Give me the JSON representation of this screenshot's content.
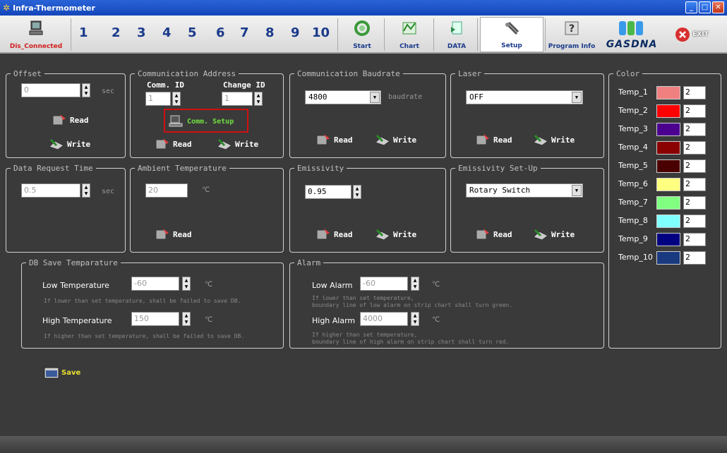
{
  "window": {
    "title": "Infra-Thermometer"
  },
  "toolbar": {
    "status": "Dis_Connected",
    "channels": [
      "1",
      "2",
      "3",
      "4",
      "5",
      "6",
      "7",
      "8",
      "9",
      "10"
    ],
    "start": "Start",
    "chart": "Chart",
    "data": "DATA",
    "setup": "Setup",
    "program_info": "Program Info",
    "brand": "GASDNA",
    "exit": "EXIT"
  },
  "offset": {
    "legend": "Offset",
    "value": "0",
    "unit": "sec",
    "read": "Read",
    "write": "Write"
  },
  "comm_address": {
    "legend": "Communication Address",
    "comm_id_label": "Comm. ID",
    "comm_id": "1",
    "change_id_label": "Change ID",
    "change_id": "1",
    "setup_btn": "Comm. Setup",
    "read": "Read",
    "write": "Write"
  },
  "baudrate": {
    "legend": "Communication Baudrate",
    "value": "4800",
    "unit": "baudrate",
    "read": "Read",
    "write": "Write"
  },
  "laser": {
    "legend": "Laser",
    "value": "OFF",
    "read": "Read",
    "write": "Write"
  },
  "data_request": {
    "legend": "Data Request Time",
    "value": "0.5",
    "unit": "sec"
  },
  "ambient": {
    "legend": "Ambient Temperature",
    "value": "20",
    "unit": "℃",
    "read": "Read"
  },
  "emissivity": {
    "legend": "Emissivity",
    "value": "0.95",
    "read": "Read",
    "write": "Write"
  },
  "emissivity_setup": {
    "legend": "Emissivity Set-Up",
    "value": "Rotary Switch",
    "read": "Read",
    "write": "Write"
  },
  "db_save": {
    "legend": "DB Save Temparature",
    "low_label": "Low Temperature",
    "low_value": "-60",
    "low_unit": "℃",
    "low_note": "If lower than set temperature, shall be failed to save DB.",
    "high_label": "High Temperature",
    "high_value": "150",
    "high_unit": "℃",
    "high_note": "If higher than set temperature, shall be failed to save DB."
  },
  "alarm": {
    "legend": "Alarm",
    "low_label": "Low Alarm",
    "low_value": "-60",
    "low_unit": "℃",
    "low_note1": "If lower than set temperature,",
    "low_note2": "boundary line of low alarm on strip chart shall turn green.",
    "high_label": "High Alarm",
    "high_value": "4000",
    "high_unit": "℃",
    "high_note1": "If higher than set temperature,",
    "high_note2": "boundary line of high alarm on strip chart shall turn red."
  },
  "color": {
    "legend": "Color",
    "items": [
      {
        "name": "Temp_1",
        "color": "#f08080",
        "width": "2"
      },
      {
        "name": "Temp_2",
        "color": "#ff0000",
        "width": "2"
      },
      {
        "name": "Temp_3",
        "color": "#4b0090",
        "width": "2"
      },
      {
        "name": "Temp_4",
        "color": "#8b0000",
        "width": "2"
      },
      {
        "name": "Temp_5",
        "color": "#4a0000",
        "width": "2"
      },
      {
        "name": "Temp_6",
        "color": "#ffff80",
        "width": "2"
      },
      {
        "name": "Temp_7",
        "color": "#80ff80",
        "width": "2"
      },
      {
        "name": "Temp_8",
        "color": "#80ffff",
        "width": "2"
      },
      {
        "name": "Temp_9",
        "color": "#000080",
        "width": "2"
      },
      {
        "name": "Temp_10",
        "color": "#1a3a80",
        "width": "2"
      }
    ]
  },
  "save": {
    "label": "Save"
  }
}
